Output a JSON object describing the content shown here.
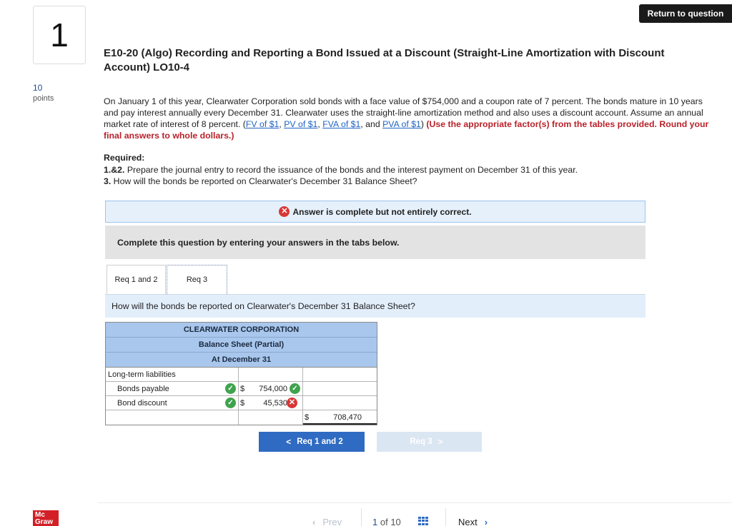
{
  "question": {
    "number": "1",
    "points_value": "10",
    "points_label": "points",
    "return_label": "Return to question",
    "title": "E10-20 (Algo) Recording and Reporting a Bond Issued at a Discount (Straight-Line Amortization with Discount Account) LO10-4"
  },
  "problem": {
    "text": "On January 1 of this year, Clearwater Corporation sold bonds with a face value of $754,000 and a coupon rate of 7 percent. The bonds mature in 10 years and pay interest annually every December 31. Clearwater uses the straight-line amortization method and also uses a discount account. Assume an annual market rate of interest of 8 percent. (",
    "links": [
      "FV of $1",
      "PV of $1",
      "FVA of $1",
      "PVA of $1"
    ],
    "sep1": ", ",
    "sep_and": ", and ",
    "close_paren": ") ",
    "instruction": "(Use the appropriate factor(s) from the tables provided. Round your final answers to whole dollars.)"
  },
  "required": {
    "heading": "Required:",
    "item1_num": "1.&2.",
    "item1_text": " Prepare the journal entry to record the issuance of the bonds and the interest payment on December 31 of this year.",
    "item2_num": "3.",
    "item2_text": " How will the bonds be reported on Clearwater's December 31 Balance Sheet?"
  },
  "status": {
    "answer_message": "Answer is complete but not entirely correct.",
    "x_glyph": "✕",
    "check_glyph": "✓"
  },
  "instructions": "Complete this question by entering your answers in the tabs below.",
  "tabs": [
    {
      "label": "Req 1 and 2"
    },
    {
      "label": "Req 3"
    }
  ],
  "question_bar": "How will the bonds be reported on  Clearwater's December 31 Balance Sheet?",
  "balance_sheet": {
    "company": "CLEARWATER CORPORATION",
    "statement": "Balance Sheet (Partial)",
    "date": "At December 31",
    "section": "Long-term liabilities",
    "rows": [
      {
        "label": "Bonds payable",
        "dollar": "$",
        "amount": "754,000",
        "label_status": "correct",
        "amount_status": "correct"
      },
      {
        "label": "Bond discount",
        "dollar": "$",
        "amount": "45,530",
        "label_status": "correct",
        "amount_status": "incorrect"
      }
    ],
    "total_dollar": "$",
    "total": "708,470"
  },
  "nav": {
    "prev_label": "Req 1 and 2",
    "next_label": "Req 3",
    "chev_left": "<",
    "chev_right": ">"
  },
  "footer": {
    "logo_line1": "Mc",
    "logo_line2": "Graw",
    "prev": "Prev",
    "page_current": "1",
    "page_of": "of",
    "page_total": "10",
    "next": "Next",
    "chev_left": "‹",
    "chev_right": "›"
  }
}
